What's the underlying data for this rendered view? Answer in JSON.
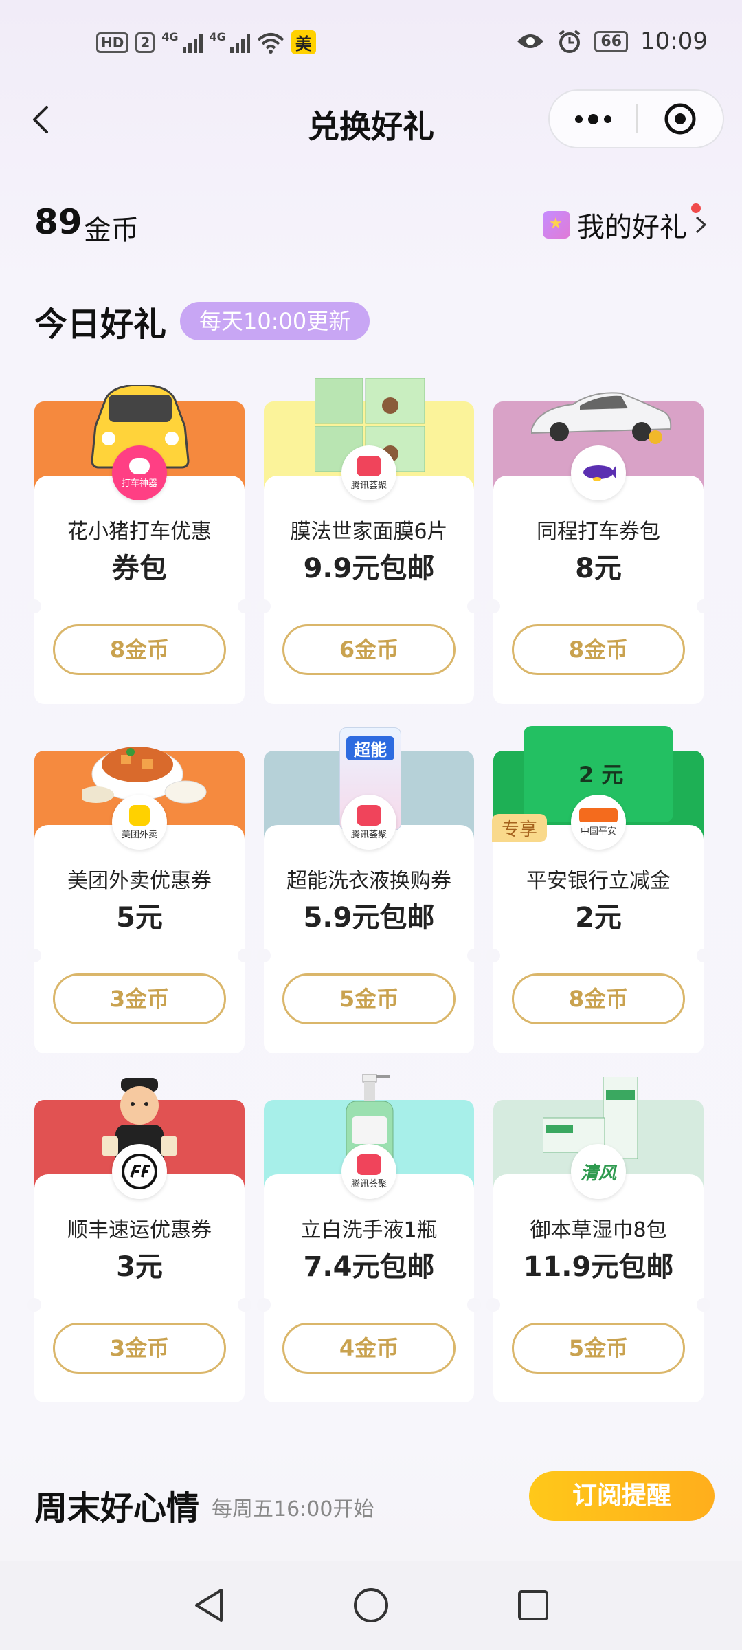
{
  "status_bar": {
    "hd": "HD",
    "sim": "2",
    "network1": "4G",
    "network2": "4G",
    "app_badge": "美",
    "battery": "66",
    "time": "10:09"
  },
  "nav": {
    "title": "兑换好礼"
  },
  "account": {
    "coins": "89",
    "coin_unit": "金币",
    "my_gifts": "我的好礼"
  },
  "today": {
    "title": "今日好礼",
    "badge": "每天10:00更新"
  },
  "cards": [
    {
      "name": "花小猪打车优惠",
      "price": "券包",
      "cost": "8金币",
      "brand": "打车神器",
      "banner": "#f5893e"
    },
    {
      "name": "膜法世家面膜6片",
      "price": "9.9元包邮",
      "cost": "6金币",
      "brand": "腾讯荟聚",
      "banner": "#fbf39a"
    },
    {
      "name": "同程打车券包",
      "price": "8元",
      "cost": "8金币",
      "brand": "",
      "banner": "#d9a2c7"
    },
    {
      "name": "美团外卖优惠券",
      "price": "5元",
      "cost": "3金币",
      "brand": "美团外卖",
      "banner": "#f58a3f"
    },
    {
      "name": "超能洗衣液换购券",
      "price": "5.9元包邮",
      "cost": "5金币",
      "brand": "腾讯荟聚",
      "banner": "#b6d1d8",
      "product_text": "超能"
    },
    {
      "name": "平安银行立减金",
      "price": "2元",
      "cost": "8金币",
      "brand": "中国平安",
      "banner": "#1eb055",
      "tag": "专享",
      "product_text": "2 元"
    },
    {
      "name": "顺丰速运优惠券",
      "price": "3元",
      "cost": "3金币",
      "brand": "",
      "banner": "#e15252"
    },
    {
      "name": "立白洗手液1瓶",
      "price": "7.4元包邮",
      "cost": "4金币",
      "brand": "腾讯荟聚",
      "banner": "#a7efe9"
    },
    {
      "name": "御本草湿巾8包",
      "price": "11.9元包邮",
      "cost": "5金币",
      "brand": "",
      "banner": "#d6ebdf",
      "brand_logo_text": "清风"
    }
  ],
  "weekend": {
    "title": "周末好心情",
    "subtitle": "每周五16:00开始",
    "subscribe": "订阅提醒"
  }
}
